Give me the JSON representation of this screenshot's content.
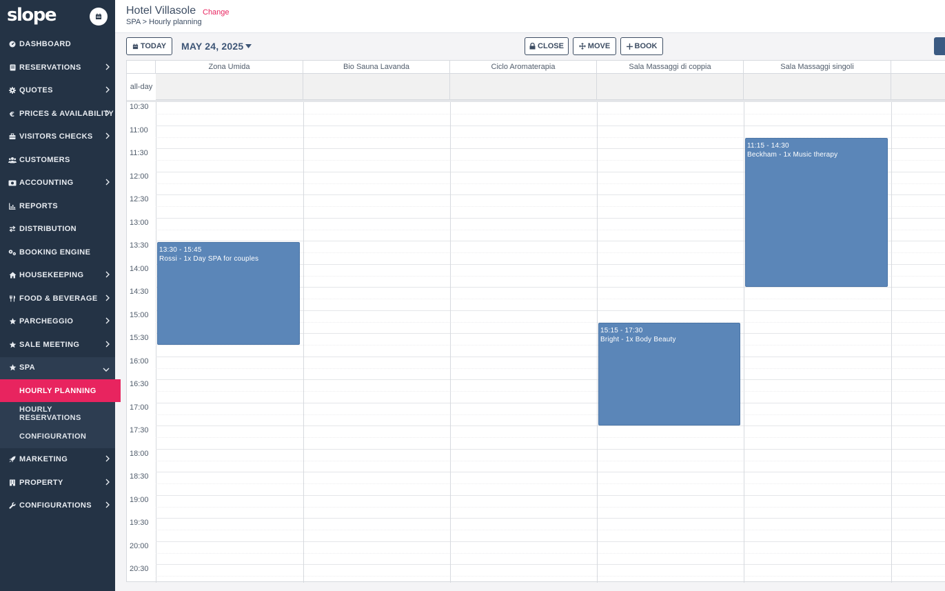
{
  "app": {
    "logo": "slope"
  },
  "header": {
    "hotel_name": "Hotel Villasole",
    "change_label": "Change",
    "breadcrumb": "SPA > Hourly planning"
  },
  "sidebar": {
    "items": [
      {
        "label": "DASHBOARD",
        "icon": "dashboard-icon",
        "chevron": false
      },
      {
        "label": "RESERVATIONS",
        "icon": "book-icon",
        "chevron": true
      },
      {
        "label": "QUOTES",
        "icon": "gear-icon",
        "chevron": true
      },
      {
        "label": "PRICES & AVAILABILITY",
        "icon": "euro-icon",
        "chevron": true
      },
      {
        "label": "VISITORS CHECKS",
        "icon": "briefcase-icon",
        "chevron": true
      },
      {
        "label": "CUSTOMERS",
        "icon": "users-icon",
        "chevron": false
      },
      {
        "label": "ACCOUNTING",
        "icon": "money-icon",
        "chevron": true
      },
      {
        "label": "REPORTS",
        "icon": "chart-icon",
        "chevron": false
      },
      {
        "label": "DISTRIBUTION",
        "icon": "exchange-icon",
        "chevron": false
      },
      {
        "label": "BOOKING ENGINE",
        "icon": "cogs-icon",
        "chevron": false
      },
      {
        "label": "HOUSEKEEPING",
        "icon": "home-icon",
        "chevron": true
      },
      {
        "label": "FOOD & BEVERAGE",
        "icon": "cutlery-icon",
        "chevron": true
      },
      {
        "label": "PARCHEGGIO",
        "icon": "star-icon",
        "chevron": true
      },
      {
        "label": "SALE MEETING",
        "icon": "star-icon",
        "chevron": true
      },
      {
        "label": "SPA",
        "icon": "star-icon",
        "chevron": "down"
      }
    ],
    "spa_sub": [
      {
        "label": "HOURLY PLANNING",
        "active": true
      },
      {
        "label": "HOURLY RESERVATIONS",
        "active": false
      },
      {
        "label": "CONFIGURATION",
        "active": false
      }
    ],
    "items_after": [
      {
        "label": "MARKETING",
        "icon": "rocket-icon",
        "chevron": true
      },
      {
        "label": "PROPERTY",
        "icon": "building-icon",
        "chevron": true
      },
      {
        "label": "CONFIGURATIONS",
        "icon": "wrench-icon",
        "chevron": true
      }
    ]
  },
  "toolbar": {
    "today_label": "TODAY",
    "date_label": "MAY 24, 2025",
    "close_label": "CLOSE",
    "move_label": "MOVE",
    "book_label": "BOOK"
  },
  "calendar": {
    "allday_label": "all-day",
    "resources": [
      "Zona Umida",
      "Bio Sauna Lavanda",
      "Ciclo Aromaterapia",
      "Sala Massaggi di coppia",
      "Sala Massaggi singoli",
      ""
    ],
    "times": [
      "10:30",
      "11:00",
      "11:30",
      "12:00",
      "12:30",
      "13:00",
      "13:30",
      "14:00",
      "14:30",
      "15:00",
      "15:30",
      "16:00",
      "16:30",
      "17:00",
      "17:30",
      "18:00",
      "18:30",
      "19:00",
      "19:30",
      "20:00",
      "20:30"
    ],
    "events": [
      {
        "resource": 0,
        "start": "13:30",
        "end": "15:45",
        "time_label": "13:30 - 15:45",
        "title": "Rossi - 1x Day SPA for couples"
      },
      {
        "resource": 3,
        "start": "15:15",
        "end": "17:30",
        "time_label": "15:15 - 17:30",
        "title": "Bright - 1x Body Beauty"
      },
      {
        "resource": 4,
        "start": "11:15",
        "end": "14:30",
        "time_label": "11:15 - 14:30",
        "title": "Beckham - 1x Music therapy"
      }
    ]
  },
  "colors": {
    "sidebar_bg": "#243345",
    "accent": "#e8245f",
    "event_bg": "#5b86b8"
  }
}
